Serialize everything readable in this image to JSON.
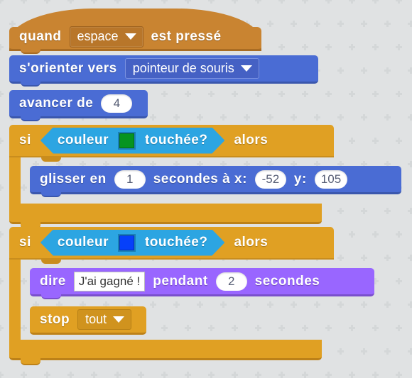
{
  "workspace": {
    "background_color": "#e0e2e3",
    "language": "fr"
  },
  "script": {
    "blocks": [
      {
        "id": "quand-espace-presse",
        "kind": "hat",
        "category": "events",
        "color": "#c98431",
        "text_before": "quand",
        "dropdown_value": "espace",
        "text_after": "est pressé"
      },
      {
        "id": "s-orienter-vers",
        "kind": "stack",
        "category": "motion",
        "color": "#4a6cd4",
        "label": "s'orienter  vers",
        "dropdown_value": "pointeur de souris"
      },
      {
        "id": "avancer-de",
        "kind": "stack",
        "category": "motion",
        "color": "#4a6cd4",
        "label": "avancer  de",
        "value": "4"
      },
      {
        "id": "si-couleur-verte-alors",
        "kind": "c-block",
        "category": "control",
        "color": "#e0a023",
        "label_if": "si",
        "label_then": "alors",
        "condition": {
          "label_before": "couleur",
          "label_after": "touchée?",
          "swatch_color": "#069420",
          "color": "#2ca5e2"
        },
        "children": [
          {
            "id": "glisser-en-secondes",
            "kind": "stack",
            "category": "motion",
            "color": "#4a6cd4",
            "label_1": "glisser  en",
            "seconds": "1",
            "label_2": "secondes  à  x:",
            "x": "-52",
            "label_3": "y:",
            "y": "105"
          }
        ]
      },
      {
        "id": "si-couleur-bleue-alors",
        "kind": "c-block",
        "category": "control",
        "color": "#e0a023",
        "label_if": "si",
        "label_then": "alors",
        "condition": {
          "label_before": "couleur",
          "label_after": "touchée?",
          "swatch_color": "#0640fa",
          "color": "#2ca5e2"
        },
        "children": [
          {
            "id": "dire-pendant-secondes",
            "kind": "stack",
            "category": "looks",
            "color": "#9966ff",
            "label_1": "dire",
            "message": "J'ai gagné !",
            "label_2": "pendant",
            "seconds": "2",
            "label_3": "secondes"
          },
          {
            "id": "stop-tout",
            "kind": "stack",
            "category": "control",
            "color": "#e0a023",
            "label": "stop",
            "dropdown_value": "tout"
          }
        ]
      }
    ]
  },
  "icons": {
    "dropdown_caret": "chevron-down-icon"
  }
}
